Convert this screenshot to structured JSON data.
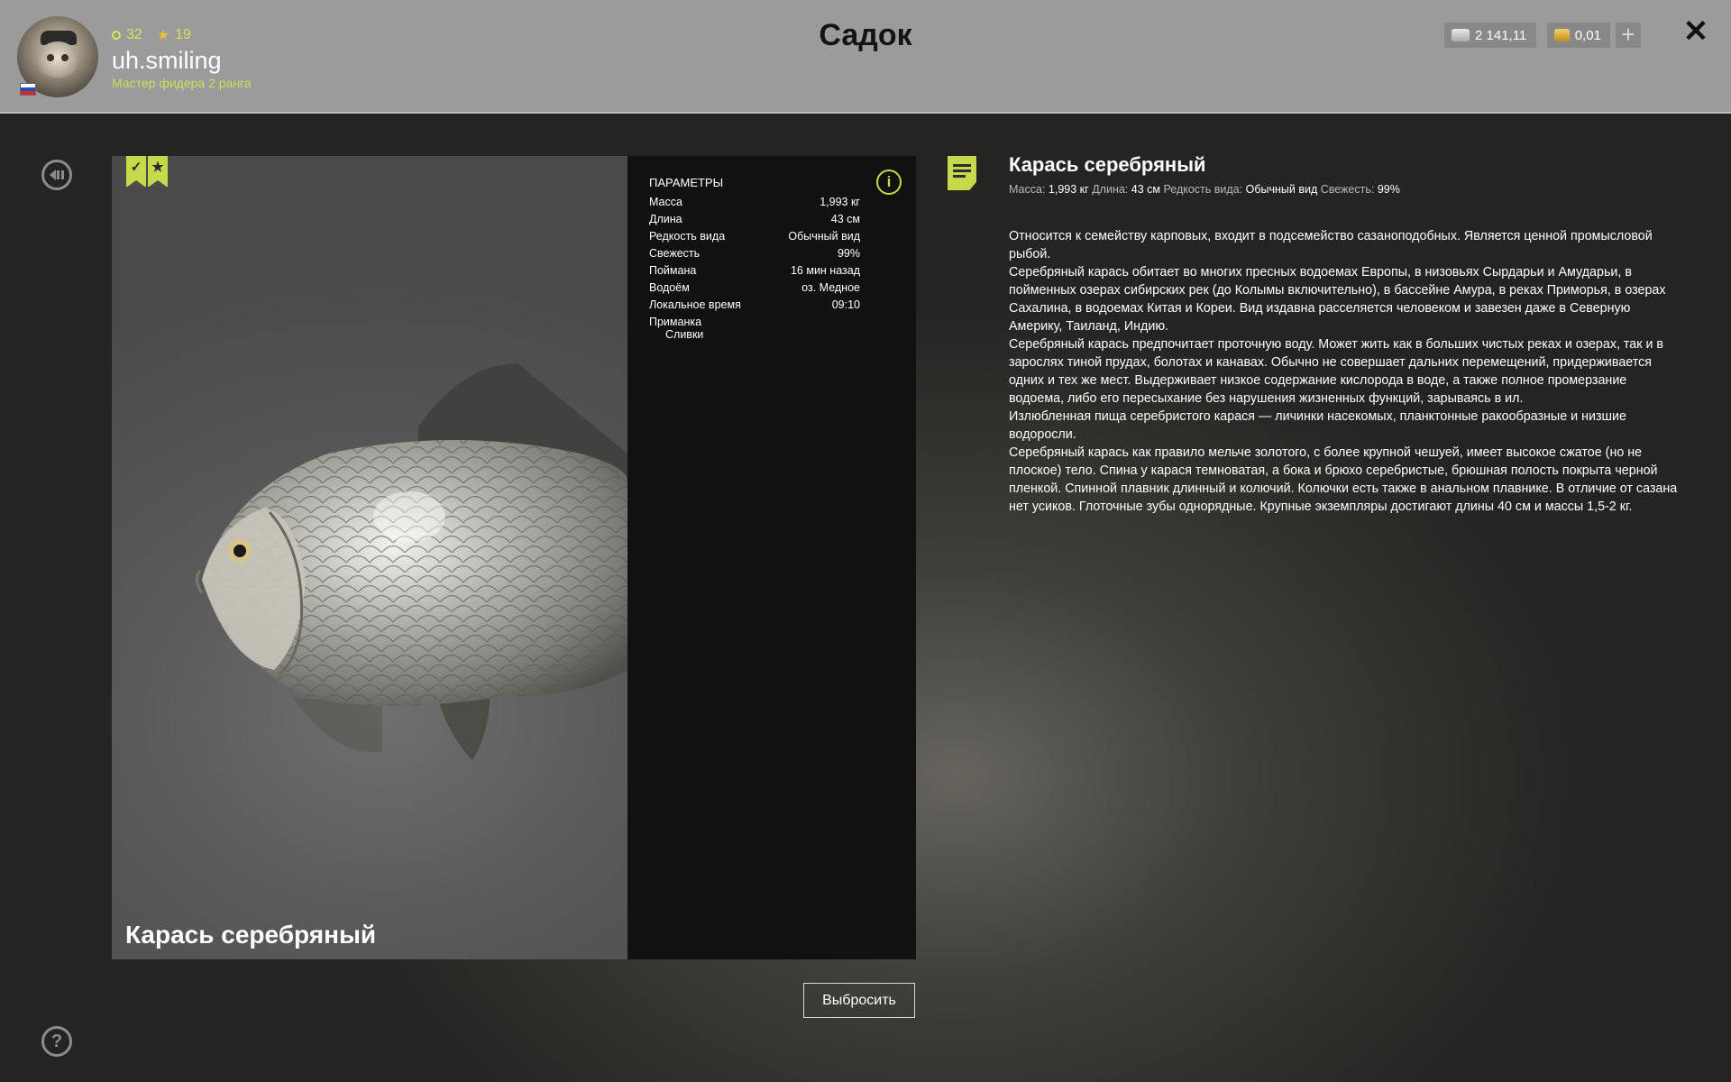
{
  "header": {
    "title": "Садок",
    "user": {
      "name": "uh.smiling",
      "rank": "Мастер фидера 2 ранга",
      "level": "32",
      "stars": "19"
    },
    "currency": {
      "silver": "2 141,11",
      "gold": "0,01",
      "add": "+"
    },
    "close": "✕"
  },
  "fish": {
    "name": "Карась серебряный",
    "params_title": "ПАРАМЕТРЫ",
    "params": [
      {
        "label": "Масса",
        "value": "1,993 кг"
      },
      {
        "label": "Длина",
        "value": "43 см"
      },
      {
        "label": "Редкость вида",
        "value": "Обычный вид"
      },
      {
        "label": "Свежесть",
        "value": "99%"
      },
      {
        "label": "Поймана",
        "value": "16 мин назад"
      },
      {
        "label": "Водоём",
        "value": "оз. Медное"
      },
      {
        "label": "Локальное время",
        "value": "09:10"
      }
    ],
    "bait_label": "Приманка",
    "bait_value": "Сливки",
    "throw_button": "Выбросить"
  },
  "description": {
    "title": "Карась серебряный",
    "meta": {
      "mass_label": "Масса:",
      "mass": "1,993 кг",
      "length_label": "Длина:",
      "length": "43 см",
      "rarity_label": "Редкость вида:",
      "rarity": "Обычный вид",
      "freshness_label": "Свежесть:",
      "freshness": "99%"
    },
    "paragraphs": [
      "Относится к семейству карповых, входит в подсемейство сазаноподобных. Является ценной промысловой рыбой.",
      "Серебряный карась обитает во многих пресных водоемах Европы, в низовьях Сырдарьи и Амударьи, в пойменных озерах сибирских рек (до Колымы включительно), в бассейне Амура, в реках Приморья, в озерах Сахалина, в водоемах Китая и Кореи. Вид издавна расселяется человеком и завезен даже в Северную Америку, Таиланд, Индию.",
      "Серебряный карась предпочитает проточную воду. Может жить как в больших чистых реках и озерах, так и в зарослях тиной прудах, болотах и канавах. Обычно не совершает дальних перемещений, придерживается одних и тех же мест. Выдерживает низкое содержание кислорода в воде, а также полное промерзание водоема, либо его пересыхание без нарушения жизненных функций, зарываясь в ил.",
      "Излюбленная пища серебристого карася — личинки насекомых, планктонные ракообразные и низшие водоросли.",
      "Серебряный карась как правило мельче золотого, с более крупной чешуей, имеет высокое сжатое (но не плоское) тело. Спина у карася темноватая, а бока и брюхо серебристые, брюшная полость покрыта черной пленкой. Спинной плавник длинный и колючий. Колючки есть также в анальном плавнике. В отличие от сазана нет усиков. Глоточные зубы однорядные. Крупные экземпляры достигают длины 40 см и массы 1,5-2 кг."
    ]
  },
  "icons": {
    "back": "back-icon",
    "help": "?",
    "info": "i",
    "check": "✓",
    "star": "★"
  },
  "colors": {
    "accent": "#c6d94a",
    "header_bg": "#9b9b9b",
    "params_bg": "#111111"
  }
}
